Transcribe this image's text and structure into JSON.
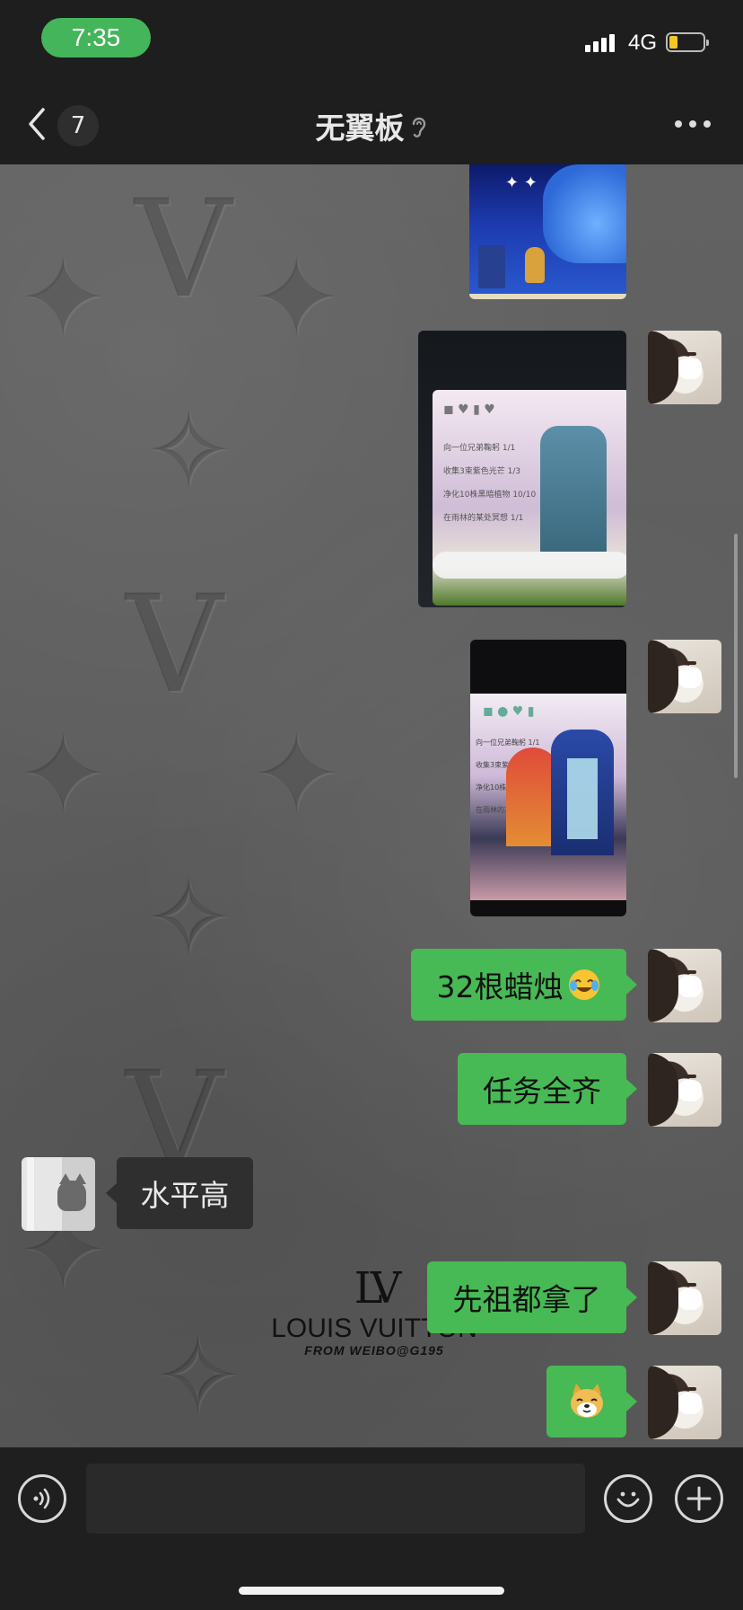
{
  "status_bar": {
    "time": "7:35",
    "network": "4G",
    "time_pill_color": "#44b55a",
    "battery_level": 0.25
  },
  "nav": {
    "back_icon": "chevron-left-icon",
    "unread_count": "7",
    "title": "无翼板",
    "title_icon": "ear-icon",
    "more_icon": "more-icon"
  },
  "messages": [
    {
      "type": "image",
      "from": "self",
      "description_icon": "game-screenshot-partial"
    },
    {
      "type": "image",
      "from": "self",
      "description_icon": "game-screenshot"
    },
    {
      "type": "image",
      "from": "self",
      "description_icon": "game-screenshot"
    },
    {
      "type": "text",
      "from": "self",
      "text": "32根蜡烛",
      "emoji": "laughing-tears-emoji"
    },
    {
      "type": "text",
      "from": "self",
      "text": "任务全齐"
    },
    {
      "type": "text",
      "from": "other",
      "text": "水平高"
    },
    {
      "type": "text",
      "from": "self",
      "text": "先祖都拿了"
    },
    {
      "type": "sticker",
      "from": "self",
      "emoji": "doge-emoji"
    }
  ],
  "wallpaper": {
    "brand_monogram": "LV",
    "brand_name": "LOUIS VUITTON",
    "credit": "FROM WEIBO@G195"
  },
  "screenshot_tasks": [
    {
      "text": "向一位兄弟鞠躬 1/1"
    },
    {
      "text": "收集3束紫色光芒 1/3"
    },
    {
      "text": "净化10株黑暗植物 10/10"
    },
    {
      "text": "在雨林的某处冥想 1/1"
    }
  ],
  "input_bar": {
    "voice_icon": "voice-icon",
    "emoji_icon": "smiley-icon",
    "plus_icon": "plus-icon"
  },
  "colors": {
    "outgoing_bubble": "#47b955",
    "incoming_bubble": "#2f2f2f",
    "bar_bg": "#1e1e1e"
  }
}
